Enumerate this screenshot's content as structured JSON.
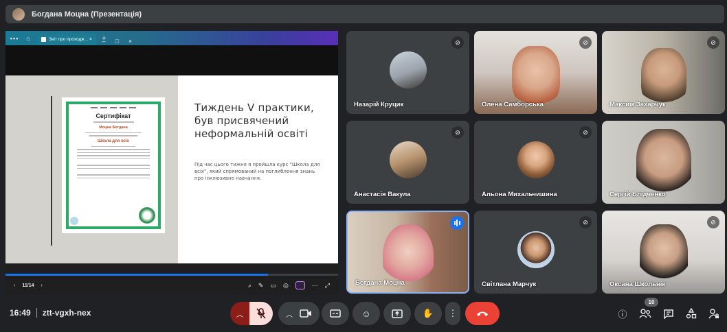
{
  "presenter_bar": {
    "title": "Богдана Моцна (Презентація)"
  },
  "presentation": {
    "browser_tab_title": "Звіт про проходж...",
    "slide": {
      "certificate": {
        "title": "Сертифікат",
        "name": "Моцна Богдана",
        "course": "Школа для всіх"
      },
      "heading": "Тиждень V практики, був присвячений неформальній освіті",
      "body": "Під час цього тижня я пройшла курс \"Школа для всіх\", який спрямований на поглиблення знань про інклюзивне навчання."
    },
    "page_indicator": "11/14",
    "progress": 0.79
  },
  "participants": [
    {
      "name": "Назарій Круцик",
      "muted": true,
      "type": "avatar"
    },
    {
      "name": "Олена Самборська",
      "muted": true,
      "type": "video"
    },
    {
      "name": "Максим Захарчук",
      "muted": true,
      "type": "video"
    },
    {
      "name": "Анастасія Вакула",
      "muted": true,
      "type": "avatar"
    },
    {
      "name": "Альона Михальчишина",
      "muted": true,
      "type": "avatar"
    },
    {
      "name": "Сергій Блідченко",
      "muted": false,
      "type": "video"
    },
    {
      "name": "Богдана Моцна",
      "muted": false,
      "speaking": true,
      "type": "video"
    },
    {
      "name": "Світлана Марчук",
      "muted": true,
      "type": "avatar"
    },
    {
      "name": "Оксана Школьнік",
      "muted": true,
      "type": "video"
    }
  ],
  "bottom_bar": {
    "time": "16:49",
    "meeting_code": "ztt-vgxh-nex",
    "people_count": "10"
  },
  "colors": {
    "accent": "#1a73e8",
    "end_call": "#ea4335",
    "mic_off_bg": "#f9dedc",
    "tile_bg": "#3c4043"
  }
}
